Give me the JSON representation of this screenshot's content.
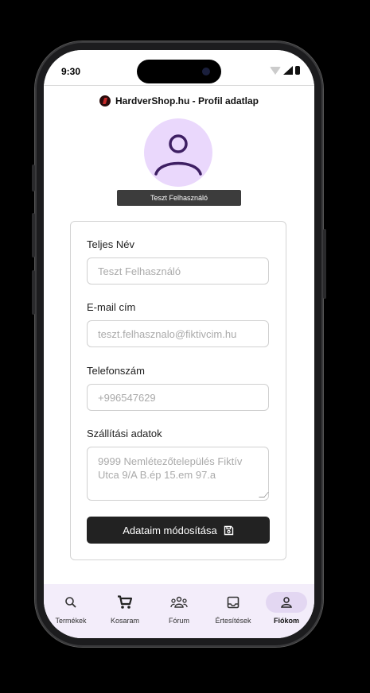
{
  "status_bar": {
    "time": "9:30"
  },
  "app_bar": {
    "title": "HardverShop.hu - Profil adatlap",
    "logo_icon": "hardvershop-logo-icon"
  },
  "profile": {
    "avatar_icon": "person-icon",
    "display_name": "Teszt Felhasználó"
  },
  "form": {
    "full_name_label": "Teljes Név",
    "full_name_placeholder": "Teszt Felhasználó",
    "email_label": "E-mail cím",
    "email_placeholder": "teszt.felhasznalo@fiktivcim.hu",
    "phone_label": "Telefonszám",
    "phone_placeholder": "+996547629",
    "shipping_label": "Szállítási adatok",
    "shipping_placeholder": "9999 Nemlétezőtelepülés Fiktív Utca 9/A B.ép 15.em 97.a",
    "submit_label": "Adataim módosítása",
    "submit_icon": "save-icon"
  },
  "bottom_nav": {
    "items": [
      {
        "label": "Termékek",
        "icon": "search-icon"
      },
      {
        "label": "Kosaram",
        "icon": "cart-icon"
      },
      {
        "label": "Fórum",
        "icon": "group-icon"
      },
      {
        "label": "Értesítések",
        "icon": "inbox-icon"
      },
      {
        "label": "Fiókom",
        "icon": "person-icon",
        "active": true
      }
    ]
  },
  "colors": {
    "accent_light": "#ead8fc",
    "nav_bg": "#f3edfa",
    "button_dark": "#222222"
  }
}
